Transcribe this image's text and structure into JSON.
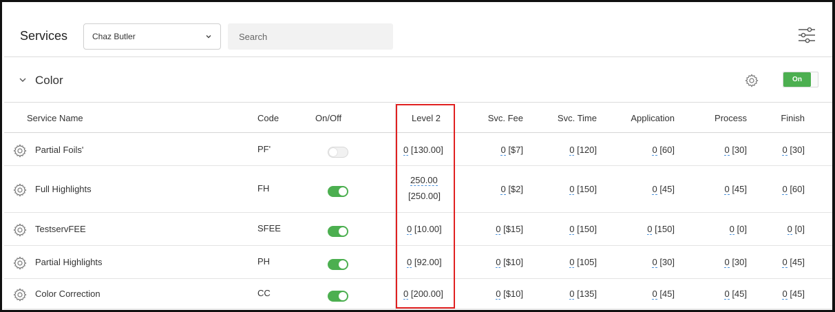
{
  "header": {
    "title": "Services",
    "staff_select": "Chaz Butler",
    "search_placeholder": "Search"
  },
  "section": {
    "title": "Color",
    "toggle_label": "On"
  },
  "columns": {
    "service_name": "Service Name",
    "code": "Code",
    "on_off": "On/Off",
    "level": "Level 2",
    "svc_fee": "Svc. Fee",
    "svc_time": "Svc. Time",
    "application": "Application",
    "process": "Process",
    "finish": "Finish"
  },
  "rows": [
    {
      "name": "Partial Foils'",
      "code": "PF'",
      "enabled": false,
      "level_val": "0",
      "level_base": "[130.00]",
      "fee_val": "0",
      "fee_base": "[$7]",
      "time_val": "0",
      "time_base": "[120]",
      "app_val": "0",
      "app_base": "[60]",
      "proc_val": "0",
      "proc_base": "[30]",
      "fin_val": "0",
      "fin_base": "[30]"
    },
    {
      "name": "Full Highlights",
      "code": "FH",
      "enabled": true,
      "level_val": "250.00",
      "level_base": "[250.00]",
      "fee_val": "0",
      "fee_base": "[$2]",
      "time_val": "0",
      "time_base": "[150]",
      "app_val": "0",
      "app_base": "[45]",
      "proc_val": "0",
      "proc_base": "[45]",
      "fin_val": "0",
      "fin_base": "[60]"
    },
    {
      "name": "TestservFEE",
      "code": "SFEE",
      "enabled": true,
      "level_val": "0",
      "level_base": "[10.00]",
      "fee_val": "0",
      "fee_base": "[$15]",
      "time_val": "0",
      "time_base": "[150]",
      "app_val": "0",
      "app_base": "[150]",
      "proc_val": "0",
      "proc_base": "[0]",
      "fin_val": "0",
      "fin_base": "[0]"
    },
    {
      "name": "Partial Highlights",
      "code": "PH",
      "enabled": true,
      "level_val": "0",
      "level_base": "[92.00]",
      "fee_val": "0",
      "fee_base": "[$10]",
      "time_val": "0",
      "time_base": "[105]",
      "app_val": "0",
      "app_base": "[30]",
      "proc_val": "0",
      "proc_base": "[30]",
      "fin_val": "0",
      "fin_base": "[45]"
    },
    {
      "name": "Color Correction",
      "code": "CC",
      "enabled": true,
      "level_val": "0",
      "level_base": "[200.00]",
      "fee_val": "0",
      "fee_base": "[$10]",
      "time_val": "0",
      "time_base": "[135]",
      "app_val": "0",
      "app_base": "[45]",
      "proc_val": "0",
      "proc_base": "[45]",
      "fin_val": "0",
      "fin_base": "[45]"
    }
  ],
  "colors": {
    "accent_green": "#4caf50",
    "highlight_red": "#e02020",
    "link_underline": "#4a90d9"
  },
  "icons": [
    "filters-icon",
    "chevron-down-icon",
    "gear-icon",
    "toggle-switch"
  ]
}
